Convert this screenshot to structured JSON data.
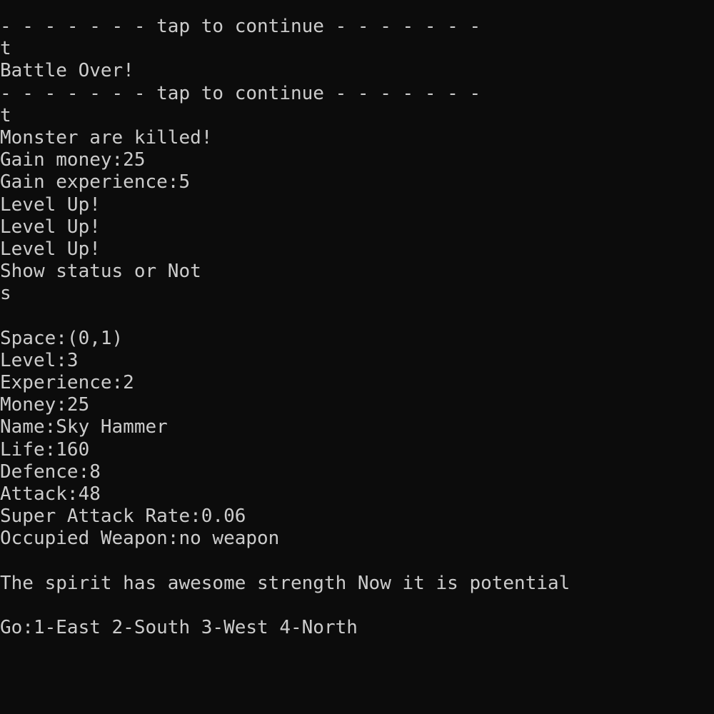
{
  "console": {
    "lines": [
      "- - - - - - - tap to continue - - - - - - -",
      "t",
      "Battle Over!",
      "- - - - - - - tap to continue - - - - - - -",
      "t",
      "Monster are killed!",
      "Gain money:25",
      "Gain experience:5",
      "Level Up!",
      "Level Up!",
      "Level Up!",
      "Show status or Not",
      "s",
      "",
      "Space:(0,1)",
      "Level:3",
      "Experience:2",
      "Money:25",
      "Name:Sky Hammer",
      "Life:160",
      "Defence:8",
      "Attack:48",
      "Super Attack Rate:0.06",
      "Occupied Weapon:no weapon",
      "",
      "The spirit has awesome strength Now it is potential",
      "",
      "Go:1-East 2-South 3-West 4-North"
    ]
  }
}
